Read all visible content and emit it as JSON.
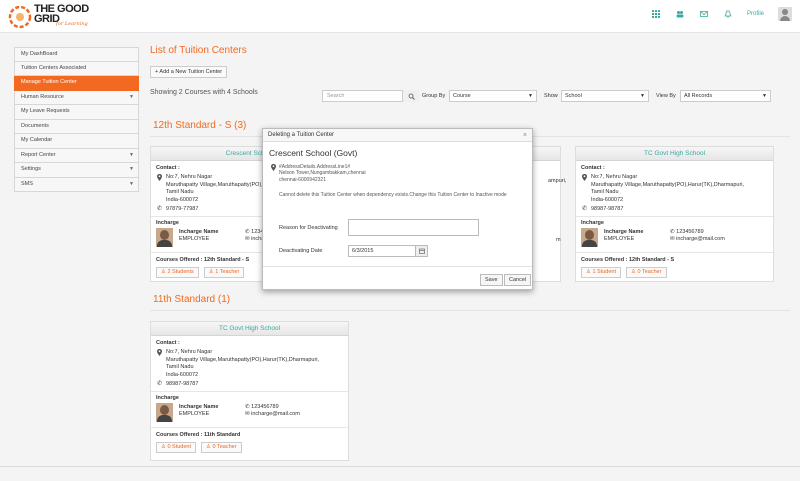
{
  "brand": {
    "name_line1": "THE GOOD",
    "name_line2": "GRID",
    "tagline": "for Learning",
    "accent": "#f26a21",
    "teal": "#3aa9a0"
  },
  "topbar": {
    "icons": [
      "grid-icon",
      "users-icon",
      "mail-icon",
      "bell-icon"
    ],
    "profile_label": "Profile"
  },
  "sidebar": {
    "items": [
      {
        "label": "My DashBoard",
        "expandable": false,
        "active": false
      },
      {
        "label": "Tuition Centers Associated",
        "expandable": false,
        "active": false
      },
      {
        "label": "Manage Tuition Center",
        "expandable": false,
        "active": true
      },
      {
        "label": "Human Resource",
        "expandable": true,
        "active": false
      },
      {
        "label": "My Leave Requests",
        "expandable": false,
        "active": false
      },
      {
        "label": "Documents",
        "expandable": false,
        "active": false
      },
      {
        "label": "My Calendar",
        "expandable": false,
        "active": false
      },
      {
        "label": "Report Center",
        "expandable": true,
        "active": false
      },
      {
        "label": "Settings",
        "expandable": true,
        "active": false
      },
      {
        "label": "SMS",
        "expandable": true,
        "active": false
      }
    ]
  },
  "main": {
    "title": "List of Tuition Centers",
    "add_button": "+ Add a New Tuition Center",
    "showing": "Showing 2 Courses with 4 Schools",
    "search_placeholder": "Search",
    "group_by_label": "Group By",
    "group_by_value": "Course",
    "show_label": "Show",
    "show_value": "School",
    "view_by_label": "View By",
    "view_by_value": "All Records"
  },
  "sections": [
    {
      "title": "12th Standard - S (3)",
      "cards": [
        {
          "name": "Crescent School",
          "contact_label": "Contact :",
          "address_lines": [
            "No:7, Nehru Nagar",
            "Maruthapatty Village,Maruthapatty(PO),Harur(TK),Dharmapuri,",
            "Tamil Nadu",
            "India-600072"
          ],
          "phone": "97879-77987",
          "incharge_label": "Incharge",
          "incharge_name_label": "Incharge Name",
          "incharge_role": "EMPLOYEE",
          "incharge_phone": "12345678",
          "incharge_mail": "incharge@mail.co",
          "courses": "Courses Offered : 12th Standard - S",
          "students": "2  Students",
          "teachers": "1 Teacher"
        },
        {
          "name": "TC Govt High School",
          "contact_label": "Contact :",
          "address_lines": [
            "No:7, Nehru Nagar",
            "Maruthapatty Village,Maruthapatty(PO),Harur(TK),Dharmapuri,",
            "Tamil Nadu",
            "India-600072"
          ],
          "phone": "98987-98787",
          "incharge_label": "Incharge",
          "incharge_name_label": "Incharge Name",
          "incharge_role": "EMPLOYEE",
          "incharge_phone": "123456789",
          "incharge_mail": "incharge@mail.com",
          "courses": "Courses Offered : 12th Standard - S",
          "students": "1  Student",
          "teachers": "0 Teacher"
        },
        {
          "partial_address": "ampuri,",
          "partial_mail": "m"
        }
      ]
    },
    {
      "title": "11th Standard (1)",
      "cards": [
        {
          "name": "TC Govt High School",
          "contact_label": "Contact :",
          "address_lines": [
            "No:7, Nehru Nagar",
            "Maruthapatty Village,Maruthapatty(PO),Harur(TK),Dharmapuri,",
            "Tamil Nadu",
            "India-600072"
          ],
          "phone": "98987-98787",
          "incharge_label": "Incharge",
          "incharge_name_label": "Incharge Name",
          "incharge_role": "EMPLOYEE",
          "incharge_phone": "123456789",
          "incharge_mail": "incharge@mail.com",
          "courses": "Courses Offered : 11th Standard",
          "students": "0  Student",
          "teachers": "0 Teacher"
        }
      ]
    }
  ],
  "modal": {
    "header": "Deleting a Tuition Center",
    "close": "×",
    "school_name": "Crescent School (Govt)",
    "address_lines": [
      "#AddressDetails.AddressLine1#",
      "Nelson Tower,Nungambakkam,chennai",
      "chennai-6000942321"
    ],
    "warning": "Cannot delete this Tuition Center when dependency exists.Change this Tuition Center to Inactive mode",
    "reason_label": "Reason for Deactivating",
    "date_label": "Deactivating Date",
    "date_value": "6/3/2015",
    "save": "Save",
    "cancel": "Cancel"
  }
}
